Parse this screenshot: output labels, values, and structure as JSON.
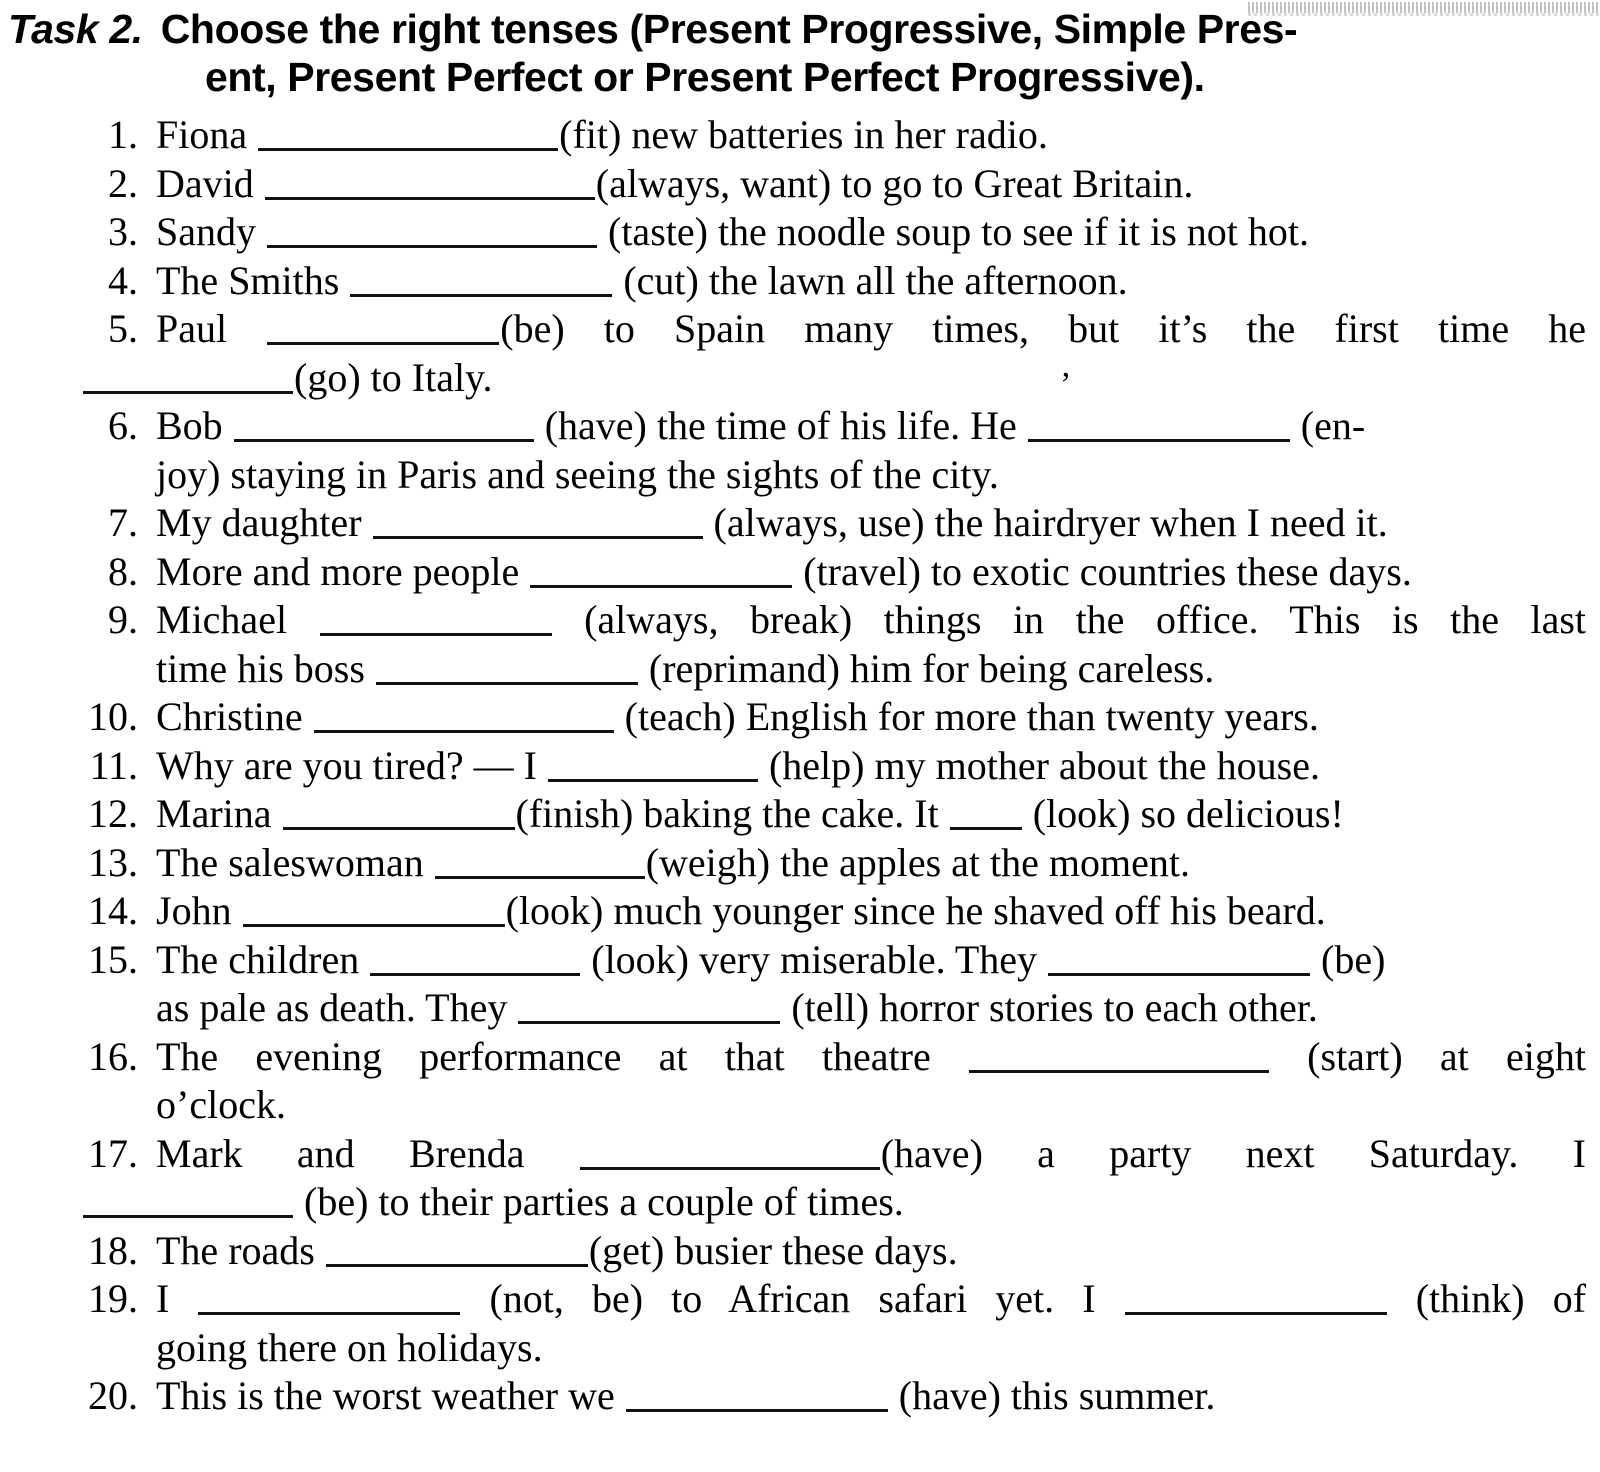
{
  "heading": {
    "task_label": "Task 2.",
    "line1": "Choose the right tenses (Present Progressive, Simple Pres-",
    "line2": "ent, Present Perfect or Present Perfect Progressive)."
  },
  "artifacts": {
    "stray_mark": "’"
  },
  "items": [
    {
      "number": "1.",
      "segments": [
        {
          "text": "Fiona "
        },
        {
          "blank": "b-xl"
        },
        {
          "text": "(fit) new batteries in her radio."
        }
      ]
    },
    {
      "number": "2.",
      "segments": [
        {
          "text": "David "
        },
        {
          "blank": "b-xxl"
        },
        {
          "text": "(always, want) to go to Great Britain."
        }
      ]
    },
    {
      "number": "3.",
      "segments": [
        {
          "text": "Sandy "
        },
        {
          "blank": "b-xxl"
        },
        {
          "text": " (taste) the noodle soup to see if it is not hot."
        }
      ]
    },
    {
      "number": "4.",
      "segments": [
        {
          "text": "The Smiths "
        },
        {
          "blank": "b-l"
        },
        {
          "text": " (cut) the lawn all the afternoon."
        }
      ]
    },
    {
      "number": "5.",
      "justified_first_line": true,
      "segments": [
        {
          "text": "Paul "
        },
        {
          "blank": "b-ml"
        },
        {
          "text": "(be) to Spain many times, but it’s the first time he"
        }
      ],
      "continuation": [
        {
          "blank": "b-m"
        },
        {
          "text": "(go) to Italy."
        }
      ],
      "continuation_indent": 0
    },
    {
      "number": "6.",
      "segments": [
        {
          "text": "Bob "
        },
        {
          "blank": "b-xl"
        },
        {
          "text": " (have) the time of his life. He "
        },
        {
          "blank": "b-l"
        },
        {
          "text": " (en-"
        }
      ],
      "continuation": [
        {
          "text": "joy) staying in Paris and seeing the sights of the city."
        }
      ]
    },
    {
      "number": "7.",
      "segments": [
        {
          "text": "My daughter "
        },
        {
          "blank": "b-xxl"
        },
        {
          "text": " (always, use) the hairdryer when I need it."
        }
      ]
    },
    {
      "number": "8.",
      "segments": [
        {
          "text": "More and more people "
        },
        {
          "blank": "b-l"
        },
        {
          "text": " (travel) to exotic countries these days."
        }
      ]
    },
    {
      "number": "9.",
      "justified_first_line": true,
      "segments": [
        {
          "text": "Michael "
        },
        {
          "blank": "b-ml"
        },
        {
          "text": " (always, break) things in the office. This is the last"
        }
      ],
      "continuation": [
        {
          "text": "time his boss "
        },
        {
          "blank": "b-l"
        },
        {
          "text": " (reprimand) him for being careless."
        }
      ]
    },
    {
      "number": "10.",
      "segments": [
        {
          "text": "Christine "
        },
        {
          "blank": "b-xl"
        },
        {
          "text": " (teach) English for more than twenty years."
        }
      ]
    },
    {
      "number": "11.",
      "segments": [
        {
          "text": "Why are you tired? — I "
        },
        {
          "blank": "b-m"
        },
        {
          "text": " (help) my mother about the house."
        }
      ]
    },
    {
      "number": "12.",
      "segments": [
        {
          "text": "Marina "
        },
        {
          "blank": "b-ml"
        },
        {
          "text": "(finish) baking the cake. It "
        },
        {
          "blank": "b-xs"
        },
        {
          "text": " (look) so delicious!"
        }
      ]
    },
    {
      "number": "13.",
      "segments": [
        {
          "text": "The saleswoman "
        },
        {
          "blank": "b-m"
        },
        {
          "text": "(weigh) the apples at the moment."
        }
      ]
    },
    {
      "number": "14.",
      "segments": [
        {
          "text": "John "
        },
        {
          "blank": "b-l"
        },
        {
          "text": "(look) much younger since he shaved off his beard."
        }
      ]
    },
    {
      "number": "15.",
      "segments": [
        {
          "text": "The children "
        },
        {
          "blank": "b-m"
        },
        {
          "text": " (look) very miserable. They "
        },
        {
          "blank": "b-l"
        },
        {
          "text": " (be)"
        }
      ],
      "continuation": [
        {
          "text": "as pale as death. They "
        },
        {
          "blank": "b-l"
        },
        {
          "text": " (tell) horror stories to each other."
        }
      ]
    },
    {
      "number": "16.",
      "justified_first_line": true,
      "segments": [
        {
          "text": "The evening performance at that theatre "
        },
        {
          "blank": "b-xl"
        },
        {
          "text": " (start) at eight"
        }
      ],
      "continuation": [
        {
          "text": "o’clock."
        }
      ]
    },
    {
      "number": "17.",
      "justified_first_line": true,
      "segments": [
        {
          "text": "Mark and Brenda "
        },
        {
          "blank": "b-xl"
        },
        {
          "text": "(have) a party next Saturday. I"
        }
      ],
      "continuation": [
        {
          "blank": "b-m"
        },
        {
          "text": " (be) to their parties a couple of times."
        }
      ],
      "continuation_indent": 0
    },
    {
      "number": "18.",
      "segments": [
        {
          "text": "The roads "
        },
        {
          "blank": "b-l"
        },
        {
          "text": "(get) busier these days."
        }
      ]
    },
    {
      "number": "19.",
      "justified_first_line": true,
      "segments": [
        {
          "text": "I "
        },
        {
          "blank": "b-l"
        },
        {
          "text": " (not, be) to African safari yet. I "
        },
        {
          "blank": "b-l"
        },
        {
          "text": " (think) of"
        }
      ],
      "continuation": [
        {
          "text": "going there on holidays."
        }
      ]
    },
    {
      "number": "20.",
      "segments": [
        {
          "text": "This is the worst weather we "
        },
        {
          "blank": "b-l"
        },
        {
          "text": " (have) this summer."
        }
      ]
    }
  ]
}
